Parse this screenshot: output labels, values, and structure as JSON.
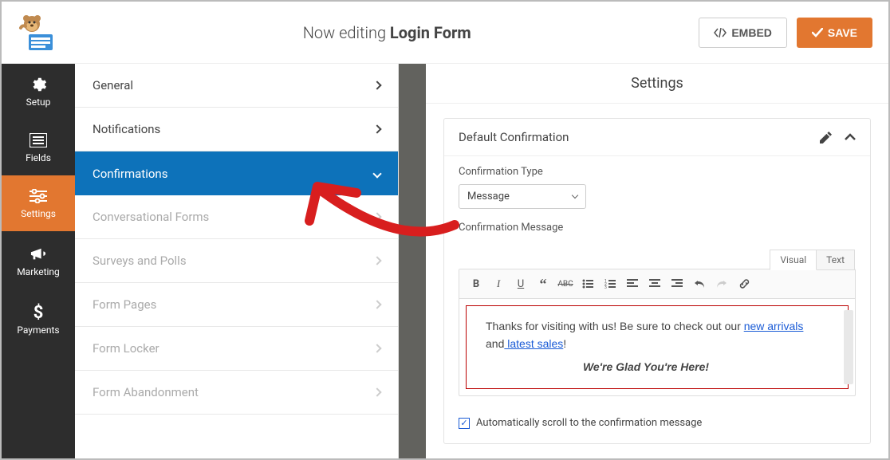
{
  "header": {
    "editing_prefix": "Now editing ",
    "form_name": "Login Form",
    "embed_label": "EMBED",
    "save_label": "SAVE"
  },
  "sidebar": {
    "items": [
      {
        "label": "Setup"
      },
      {
        "label": "Fields"
      },
      {
        "label": "Settings"
      },
      {
        "label": "Marketing"
      },
      {
        "label": "Payments"
      }
    ]
  },
  "submenu": {
    "items": [
      {
        "label": "General"
      },
      {
        "label": "Notifications"
      },
      {
        "label": "Confirmations"
      },
      {
        "label": "Conversational Forms"
      },
      {
        "label": "Surveys and Polls"
      },
      {
        "label": "Form Pages"
      },
      {
        "label": "Form Locker"
      },
      {
        "label": "Form Abandonment"
      }
    ]
  },
  "main": {
    "title": "Settings",
    "panel_title": "Default Confirmation",
    "type_label": "Confirmation Type",
    "type_value": "Message",
    "message_label": "Confirmation Message",
    "tabs": {
      "visual": "Visual",
      "text": "Text"
    },
    "message": {
      "line1_a": "Thanks for visiting with us! Be sure to check out our ",
      "link1": "new arrivals",
      "line1_b": " and",
      "link2": " latest sales",
      "line1_c": "!",
      "line2": "We're Glad You're Here!"
    },
    "autoscroll_label": "Automatically scroll to the confirmation message",
    "autoscroll_checked": true
  }
}
